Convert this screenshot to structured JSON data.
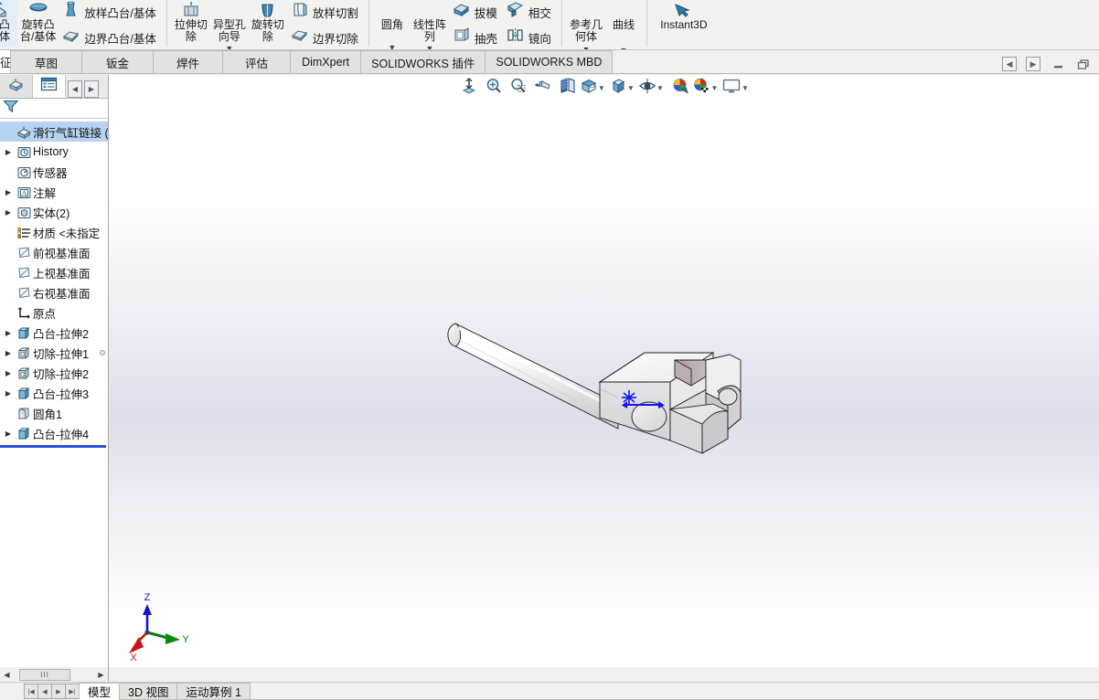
{
  "ribbon": {
    "groups": [
      {
        "id": "boss",
        "big": [
          {
            "name": "extruded-boss-base",
            "label": "伸凸\n基体",
            "icon": "extrude-boss-icon",
            "caret": false
          },
          {
            "name": "revolved-boss-base",
            "label": "旋转凸\n台/基体",
            "icon": "revolve-boss-icon",
            "caret": false
          }
        ],
        "small": [
          {
            "name": "lofted-boss-base",
            "label": "放样凸台/基体",
            "icon": "loft-boss-icon"
          },
          {
            "name": "boundary-boss-base",
            "label": "边界凸台/基体",
            "icon": "boundary-boss-icon"
          }
        ]
      },
      {
        "id": "cut",
        "big": [
          {
            "name": "extruded-cut",
            "label": "拉伸切\n除",
            "icon": "extrude-cut-icon",
            "caret": false
          },
          {
            "name": "hole-wizard",
            "label": "异型孔\n向导",
            "icon": "hole-wizard-icon",
            "caret": true
          },
          {
            "name": "revolved-cut",
            "label": "旋转切\n除",
            "icon": "revolve-cut-icon",
            "caret": false
          }
        ],
        "small": [
          {
            "name": "lofted-cut",
            "label": "放样切割",
            "icon": "loft-cut-icon"
          },
          {
            "name": "boundary-cut",
            "label": "边界切除",
            "icon": "boundary-cut-icon"
          }
        ]
      },
      {
        "id": "feature",
        "big": [
          {
            "name": "fillet",
            "label": "圆角",
            "icon": "fillet-icon",
            "caret": true
          },
          {
            "name": "linear-pattern",
            "label": "线性阵\n列",
            "icon": "linear-pattern-icon",
            "caret": true
          }
        ],
        "small": [
          {
            "name": "draft",
            "label": "拔模",
            "icon": "draft-icon"
          },
          {
            "name": "shell",
            "label": "抽壳",
            "icon": "shell-icon"
          }
        ],
        "small2": [
          {
            "name": "intersect",
            "label": "相交",
            "icon": "intersect-icon"
          },
          {
            "name": "mirror",
            "label": "镜向",
            "icon": "mirror-icon"
          }
        ]
      },
      {
        "id": "geometry",
        "big": [
          {
            "name": "reference-geometry",
            "label": "参考几\n何体",
            "icon": "reference-geometry-icon",
            "caret": true
          },
          {
            "name": "curves",
            "label": "曲线",
            "icon": "curves-icon",
            "caret": true
          }
        ],
        "small": []
      },
      {
        "id": "instant3d",
        "big": [
          {
            "name": "instant3d",
            "label": "Instant3D",
            "icon": "instant3d-icon",
            "caret": false
          }
        ],
        "small": []
      }
    ]
  },
  "tabs": {
    "items": [
      {
        "name": "tab-features",
        "label": "征",
        "cut": true,
        "active": false
      },
      {
        "name": "tab-sketch",
        "label": "草图",
        "cut": false,
        "active": false
      },
      {
        "name": "tab-sheetmetal",
        "label": "钣金",
        "cut": false,
        "active": false
      },
      {
        "name": "tab-weldments",
        "label": "焊件",
        "cut": false,
        "active": false
      },
      {
        "name": "tab-evaluate",
        "label": "评估",
        "cut": false,
        "active": false
      },
      {
        "name": "tab-dimxpert",
        "label": "DimXpert",
        "cut": false,
        "active": false
      },
      {
        "name": "tab-sw-addins",
        "label": "SOLIDWORKS 插件",
        "cut": false,
        "active": false
      },
      {
        "name": "tab-sw-mbd",
        "label": "SOLIDWORKS MBD",
        "cut": false,
        "active": false
      }
    ]
  },
  "window_controls": {
    "pane_left": "◀",
    "pane_right": "▶",
    "minimize": "—",
    "restore": "❐"
  },
  "feature_manager": {
    "tabs": [
      {
        "name": "fm-tab-feature-tree",
        "icon": "part-tree-icon",
        "active": false
      },
      {
        "name": "fm-tab-property-manager",
        "icon": "property-manager-icon",
        "active": true
      }
    ],
    "arrows": {
      "left": "◀",
      "right": "▶"
    },
    "filter_icon": "filter-icon",
    "tree": [
      {
        "name": "tree-item-root",
        "label": "滑行气缸链接  (默",
        "icon": "part-icon",
        "indent": 0,
        "expand": "none",
        "selected": true
      },
      {
        "name": "tree-item-history",
        "label": "History",
        "icon": "history-icon",
        "indent": 1,
        "expand": "collapsed",
        "selected": false
      },
      {
        "name": "tree-item-sensors",
        "label": "传感器",
        "icon": "sensor-icon",
        "indent": 1,
        "expand": "none",
        "selected": false
      },
      {
        "name": "tree-item-annotations",
        "label": "注解",
        "icon": "annotation-icon",
        "indent": 1,
        "expand": "collapsed",
        "selected": false
      },
      {
        "name": "tree-item-solid-bodies",
        "label": "实体(2)",
        "icon": "solid-bodies-icon",
        "indent": 1,
        "expand": "collapsed",
        "selected": false
      },
      {
        "name": "tree-item-material",
        "label": "材质 <未指定",
        "icon": "material-icon",
        "indent": 1,
        "expand": "none",
        "selected": false
      },
      {
        "name": "tree-item-front-plane",
        "label": "前视基准面",
        "icon": "plane-icon",
        "indent": 1,
        "expand": "none",
        "selected": false
      },
      {
        "name": "tree-item-top-plane",
        "label": "上视基准面",
        "icon": "plane-icon",
        "indent": 1,
        "expand": "none",
        "selected": false
      },
      {
        "name": "tree-item-right-plane",
        "label": "右视基准面",
        "icon": "plane-icon",
        "indent": 1,
        "expand": "none",
        "selected": false
      },
      {
        "name": "tree-item-origin",
        "label": "原点",
        "icon": "origin-icon",
        "indent": 1,
        "expand": "none",
        "selected": false
      },
      {
        "name": "tree-item-boss-extrude2",
        "label": "凸台-拉伸2",
        "icon": "boss-extrude-icon",
        "indent": 1,
        "expand": "collapsed",
        "selected": false
      },
      {
        "name": "tree-item-cut-extrude1",
        "label": "切除-拉伸1",
        "icon": "cut-extrude-icon",
        "indent": 1,
        "expand": "collapsed",
        "selected": false
      },
      {
        "name": "tree-item-cut-extrude2",
        "label": "切除-拉伸2",
        "icon": "cut-extrude-icon",
        "indent": 1,
        "expand": "collapsed",
        "selected": false
      },
      {
        "name": "tree-item-boss-extrude3",
        "label": "凸台-拉伸3",
        "icon": "boss-extrude-icon",
        "indent": 1,
        "expand": "collapsed",
        "selected": false
      },
      {
        "name": "tree-item-fillet1",
        "label": "圆角1",
        "icon": "fillet-feature-icon",
        "indent": 1,
        "expand": "none",
        "selected": false
      },
      {
        "name": "tree-item-boss-extrude4",
        "label": "凸台-拉伸4",
        "icon": "boss-extrude-icon",
        "indent": 1,
        "expand": "collapsed",
        "selected": false
      }
    ]
  },
  "heads_up_toolbar": {
    "buttons": [
      {
        "name": "zoom-to-fit-icon",
        "caret": false
      },
      {
        "name": "zoom-to-area-icon",
        "caret": false
      },
      {
        "name": "zoom-in-out-icon",
        "caret": false
      },
      {
        "name": "previous-view-icon",
        "caret": false
      },
      {
        "name": "section-view-icon",
        "caret": false
      },
      {
        "name": "view-orientation-icon",
        "caret": true
      },
      {
        "name": "display-style-icon",
        "caret": true
      },
      {
        "name": "hide-show-items-icon",
        "caret": true
      },
      {
        "name": "edit-appearance-icon",
        "caret": false
      },
      {
        "name": "apply-scene-icon",
        "caret": true
      },
      {
        "name": "view-settings-icon",
        "caret": true
      }
    ]
  },
  "viewport": {
    "triad": {
      "x_label": "X",
      "y_label": "Y",
      "z_label": "Z",
      "x_color": "#cc0000",
      "y_color": "#008a00",
      "z_color": "#0000cc"
    },
    "origin_marker_color": "#1414ff",
    "model_name": "clevis-rod-part"
  },
  "hscroll": {
    "left_arrow": "◀",
    "right_arrow": "▶",
    "thumb_grip": "III"
  },
  "status_bar": {
    "nav": [
      {
        "name": "nav-first-button",
        "glyph": "|◀"
      },
      {
        "name": "nav-prev-button",
        "glyph": "◀"
      },
      {
        "name": "nav-next-button",
        "glyph": "▶"
      },
      {
        "name": "nav-last-button",
        "glyph": "▶|"
      }
    ],
    "tabs": [
      {
        "name": "bottom-tab-model",
        "label": "模型",
        "active": true
      },
      {
        "name": "bottom-tab-3dviews",
        "label": "3D 视图",
        "active": false
      },
      {
        "name": "bottom-tab-motionstudy",
        "label": "运动算例 1",
        "active": false
      }
    ]
  }
}
